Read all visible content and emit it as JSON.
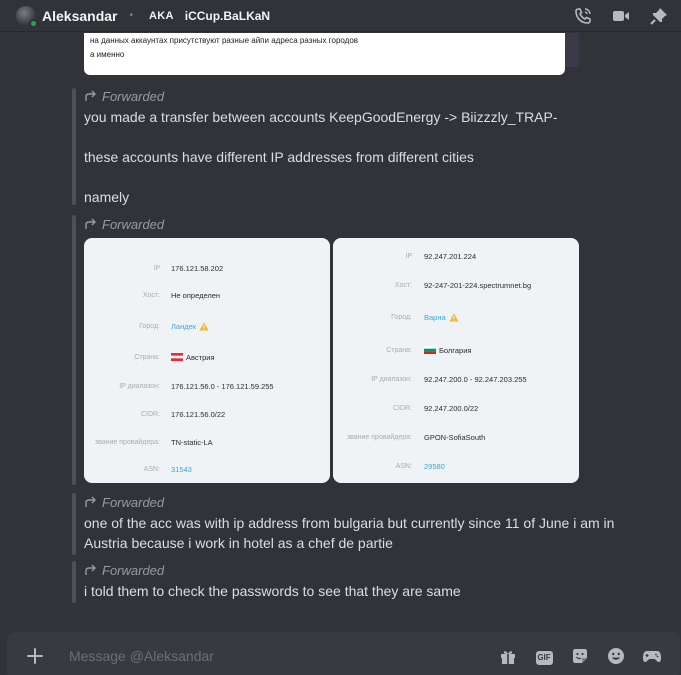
{
  "header": {
    "name": "Aleksandar",
    "aka_label": "AKA",
    "nickname": "iCCup.BaLKaN",
    "separator": "•",
    "icons": [
      "call-icon",
      "video-icon",
      "pin-icon"
    ]
  },
  "top_image_lines": [
    "на данных аккаунтах присутствуют разные айпи адреса разных городов",
    "а именно"
  ],
  "forward_label": "Forwarded",
  "messages": [
    {
      "forwarded": true,
      "lines": [
        "you made a transfer between accounts KeepGoodEnergy -> Biizzzly_TRAP-",
        "",
        "these accounts have different IP addresses from different cities",
        "",
        "namely"
      ]
    },
    {
      "forwarded": true,
      "lines": []
    },
    {
      "forwarded": true,
      "lines": [
        "one of the acc was with ip address from bulgaria but currently since 11 of June i am in Austria because i work in hotel as a chef de partie"
      ]
    },
    {
      "forwarded": true,
      "lines": [
        "i told them to check the passwords to see that they are same"
      ]
    }
  ],
  "ip_cards": [
    {
      "rows": [
        {
          "label": "IP",
          "value": "176.121.58.202"
        },
        {
          "label": "Хост:",
          "value": "Не определен"
        },
        {
          "label": "Город:",
          "value": "Ландек",
          "link": true,
          "warn": true
        },
        {
          "label": "Страна:",
          "value": "Австрия",
          "flag": "austria"
        },
        {
          "label": "IP диапазон:",
          "value": "176.121.56.0 - 176.121.59.255"
        },
        {
          "label": "CIDR:",
          "value": "176.121.56.0/22"
        },
        {
          "label": "звание провайдера:",
          "value": "TN-static-LA"
        },
        {
          "label": "ASN:",
          "value": "31543",
          "link": true
        }
      ]
    },
    {
      "rows": [
        {
          "label": "IP",
          "value": "92.247.201.224"
        },
        {
          "label": "Хост:",
          "value": "92-247-201-224.spectrumnet.bg"
        },
        {
          "label": "Город:",
          "value": "Варна",
          "link": true,
          "warn": true
        },
        {
          "label": "Страна:",
          "value": "Болгария",
          "flag": "bulgaria"
        },
        {
          "label": "IP диапазон:",
          "value": "92.247.200.0 - 92.247.203.255"
        },
        {
          "label": "CIDR:",
          "value": "92.247.200.0/22"
        },
        {
          "label": "звание провайдера:",
          "value": "GPON-SofiaSouth"
        },
        {
          "label": "ASN:",
          "value": "29580",
          "link": true
        }
      ]
    }
  ],
  "composer": {
    "placeholder": "Message @Aleksandar",
    "gif_label": "GIF",
    "icons": [
      "gift-icon",
      "gif-icon",
      "sticker-icon",
      "emoji-icon",
      "activity-icon"
    ]
  },
  "colors": {
    "background": "#313338",
    "composer": "#383a40",
    "link": "#3aa8d8",
    "online": "#23a55a",
    "warning": "#f0b232"
  }
}
